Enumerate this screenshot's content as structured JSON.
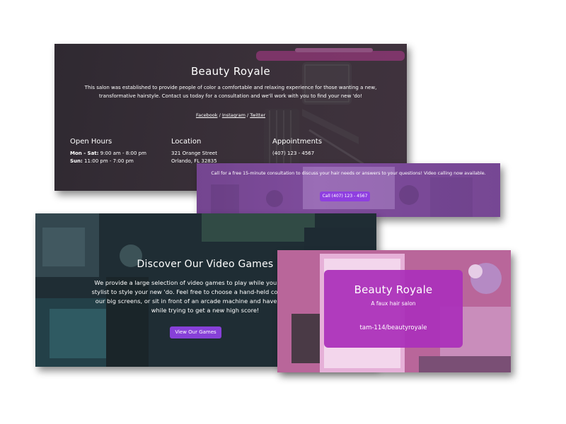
{
  "footer": {
    "title": "Beauty Royale",
    "intro": "This salon was established to provide people of color a comfortable and relaxing experience for those wanting a new, transformative hairstyle. Contact us today for a consultation and we'll work with you to find your new 'do!",
    "social": {
      "facebook": "Facebook",
      "sep1": " / ",
      "instagram": "Instagram",
      "sep2": " / ",
      "twitter": "Twitter"
    },
    "hours": {
      "heading": "Open Hours",
      "row1_label": "Mon - Sat:",
      "row1_value": " 9:00 am - 8:00 pm",
      "row2_label": "Sun:",
      "row2_value": " 11:00 pm - 7:00 pm"
    },
    "location": {
      "heading": "Location",
      "line1": "321 Orange Street",
      "line2": "Orlando, FL 32835"
    },
    "appointments": {
      "heading": "Appointments",
      "line1": "(407) 123 - 4567"
    }
  },
  "consultation": {
    "text": "Call for a free 15-minute consultation to discuss your hair needs or answers to your questions! Video calling now available.",
    "button": "Call (407) 123 - 4567"
  },
  "games": {
    "title": "Discover Our Video Games",
    "description": "We provide a large selection of video games to play while you wait for your stylist to style your new 'do. Feel free to choose a hand-held console, play on our big screens, or sit in front of an arcade machine and have a great time while trying to get a new high score!",
    "button": "View Our Games"
  },
  "hero": {
    "title": "Beauty Royale",
    "subtitle": "A faux hair salon",
    "handle": "tam-114/beautyroyale"
  },
  "colors": {
    "dark_bg": "#342c35",
    "accent_purple": "#8f3fe0",
    "hero_card": "#ab31ba",
    "banner": "#8a55a8"
  }
}
